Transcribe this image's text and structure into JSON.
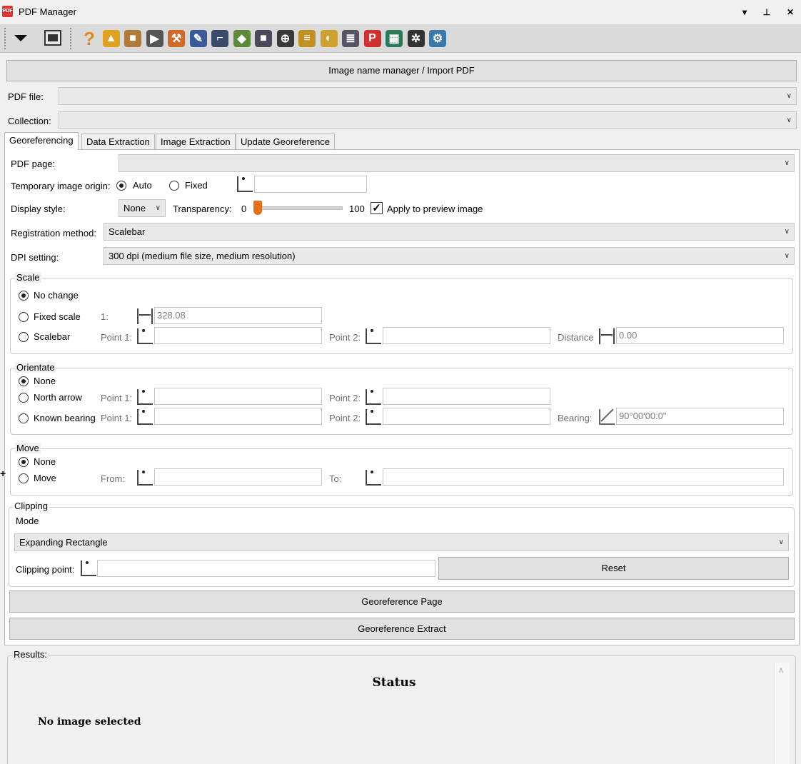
{
  "window": {
    "title": "PDF Manager",
    "icon_text": "PDF",
    "controls": [
      "▾",
      "⊥",
      "✕"
    ]
  },
  "toolbar": {
    "icons": [
      {
        "name": "help-icon",
        "glyph": "?",
        "color": "#e08a1e"
      },
      {
        "name": "image-settings-icon",
        "glyph": "▲",
        "color": "#e0a020"
      },
      {
        "name": "import-icon",
        "glyph": "■",
        "color": "#b07a3a"
      },
      {
        "name": "select-icon",
        "glyph": "▶",
        "color": "#555555"
      },
      {
        "name": "survey-icon",
        "glyph": "⚒",
        "color": "#d06a2a"
      },
      {
        "name": "pen-icon",
        "glyph": "✎",
        "color": "#3a5a9a"
      },
      {
        "name": "line-icon",
        "glyph": "⌐",
        "color": "#3a4a6a"
      },
      {
        "name": "cube-icon",
        "glyph": "◆",
        "color": "#5a8a3a"
      },
      {
        "name": "box-icon",
        "glyph": "■",
        "color": "#4a4a5a"
      },
      {
        "name": "target-icon",
        "glyph": "⊕",
        "color": "#3a3a3a"
      },
      {
        "name": "layers-icon",
        "glyph": "≡",
        "color": "#c09020"
      },
      {
        "name": "eraser-icon",
        "glyph": "◐",
        "color": "#d0a030"
      },
      {
        "name": "stack-icon",
        "glyph": "≣",
        "color": "#555566"
      },
      {
        "name": "pdf-icon",
        "glyph": "P",
        "color": "#d03030"
      },
      {
        "name": "map-icon",
        "glyph": "▦",
        "color": "#2a7a5a"
      },
      {
        "name": "gear-icon",
        "glyph": "✲",
        "color": "#333333"
      },
      {
        "name": "network-icon",
        "glyph": "⚙",
        "color": "#3a7aaa"
      }
    ]
  },
  "header_button": "Image name manager / Import PDF",
  "pdf_file": {
    "label": "PDF file:",
    "value": ""
  },
  "collection": {
    "label": "Collection:",
    "value": ""
  },
  "tabs": [
    "Georeferencing",
    "Data Extraction",
    "Image Extraction",
    "Update Georeference"
  ],
  "georef": {
    "pdf_page_label": "PDF page:",
    "origin_label": "Temporary image origin:",
    "origin_auto": "Auto",
    "origin_fixed": "Fixed",
    "display_style_label": "Display style:",
    "display_style_value": "None",
    "transparency_label": "Transparency:",
    "transparency_min": "0",
    "transparency_max": "100",
    "transparency_value": 0,
    "apply_preview_label": "Apply to preview image",
    "registration_label": "Registration method:",
    "registration_value": "Scalebar",
    "dpi_label": "DPI setting:",
    "dpi_value": "300 dpi (medium file size, medium resolution)"
  },
  "scale": {
    "title": "Scale",
    "no_change": "No change",
    "fixed_scale": "Fixed scale",
    "ratio_prefix": "1:",
    "fixed_value": "328.08",
    "scalebar": "Scalebar",
    "point1": "Point 1:",
    "point2": "Point 2:",
    "distance": "Distance",
    "distance_value": "0.00"
  },
  "orientate": {
    "title": "Orientate",
    "none": "None",
    "north_arrow": "North arrow",
    "known_bearing": "Known bearing",
    "point1": "Point 1:",
    "point2": "Point 2:",
    "bearing_label": "Bearing:",
    "bearing_value": "90°00'00.0\""
  },
  "move": {
    "title": "Move",
    "none": "None",
    "move": "Move",
    "from": "From:",
    "to": "To:"
  },
  "clipping": {
    "title": "Clipping",
    "mode_label": "Mode",
    "mode_value": "Expanding Rectangle",
    "point_label": "Clipping point:",
    "reset": "Reset"
  },
  "actions": {
    "georef_page": "Georeference Page",
    "georef_extract": "Georeference Extract"
  },
  "results": {
    "title": "Results:",
    "status_heading": "Status",
    "status_text": "No image selected"
  }
}
